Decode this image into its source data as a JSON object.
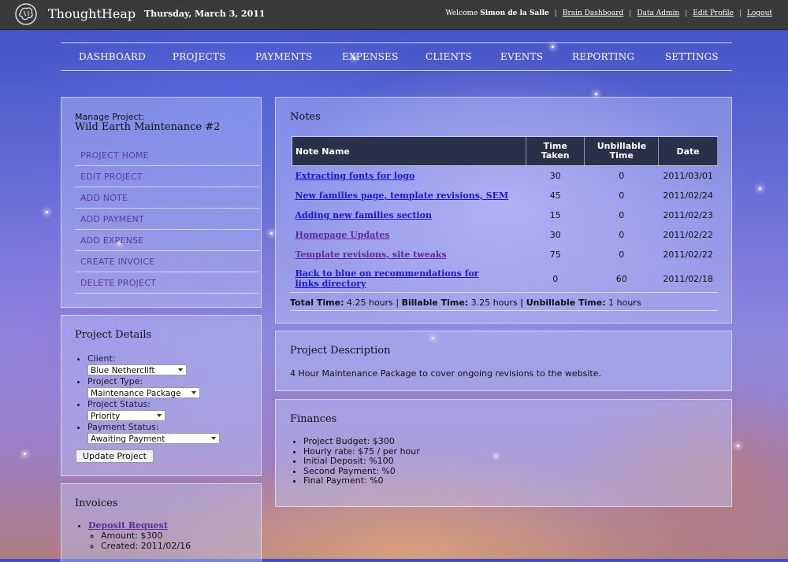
{
  "header": {
    "app_title": "ThoughtHeap",
    "date": "Thursday, March 3, 2011",
    "welcome_prefix": "Welcome",
    "user_name": "Simon de la Salle",
    "links": [
      "Brain Dashboard",
      "Data Admin",
      "Edit Profile",
      "Logout"
    ]
  },
  "nav": [
    "DASHBOARD",
    "PROJECTS",
    "PAYMENTS",
    "EXPENSES",
    "CLIENTS",
    "EVENTS",
    "REPORTING",
    "SETTINGS"
  ],
  "manage": {
    "label": "Manage Project:",
    "project_name": "Wild Earth Maintenance #2",
    "menu": [
      "PROJECT HOME",
      "EDIT PROJECT",
      "ADD NOTE",
      "ADD PAYMENT",
      "ADD EXPENSE",
      "CREATE INVOICE",
      "DELETE PROJECT"
    ]
  },
  "details": {
    "title": "Project Details",
    "client_label": "Client:",
    "client_value": "Blue Netherclift",
    "type_label": "Project Type:",
    "type_value": "Maintenance Package",
    "status_label": "Project Status:",
    "status_value": "Priority",
    "payment_label": "Payment Status:",
    "payment_value": "Awaiting Payment",
    "update_button": "Update Project"
  },
  "invoices": {
    "title": "Invoices",
    "items": [
      {
        "name": "Deposit Request",
        "amount": "Amount: $300",
        "created": "Created: 2011/02/16"
      }
    ]
  },
  "notes": {
    "title": "Notes",
    "columns": [
      "Note Name",
      "Time Taken",
      "Unbillable Time",
      "Date"
    ],
    "rows": [
      {
        "name": "Extracting fonts for logo",
        "time": "30",
        "unbillable": "0",
        "date": "2011/03/01"
      },
      {
        "name": "New families page, template revisions, SEM",
        "time": "45",
        "unbillable": "0",
        "date": "2011/02/24"
      },
      {
        "name": "Adding new families section",
        "time": "15",
        "unbillable": "0",
        "date": "2011/02/23"
      },
      {
        "name": "Homepage Updates",
        "time": "30",
        "unbillable": "0",
        "date": "2011/02/22"
      },
      {
        "name": "Template revisions, site tweaks",
        "time": "75",
        "unbillable": "0",
        "date": "2011/02/22"
      },
      {
        "name": "Back to blue on recommendations for links directory",
        "time": "0",
        "unbillable": "60",
        "date": "2011/02/18"
      }
    ],
    "totals": {
      "total_label": "Total Time:",
      "total_value": "4.25 hours",
      "billable_label": "Billable Time:",
      "billable_value": "3.25 hours",
      "unbillable_label": "Unbillable Time:",
      "unbillable_value": "1 hours"
    }
  },
  "description": {
    "title": "Project Description",
    "text": "4 Hour Maintenance Package to cover ongoing revisions to the website."
  },
  "finances": {
    "title": "Finances",
    "items": [
      "Project Budget: $300",
      "Hourly rate: $75 / per hour",
      "Initial Deposit: %100",
      "Second Payment: %0",
      "Final Payment: %0"
    ]
  }
}
